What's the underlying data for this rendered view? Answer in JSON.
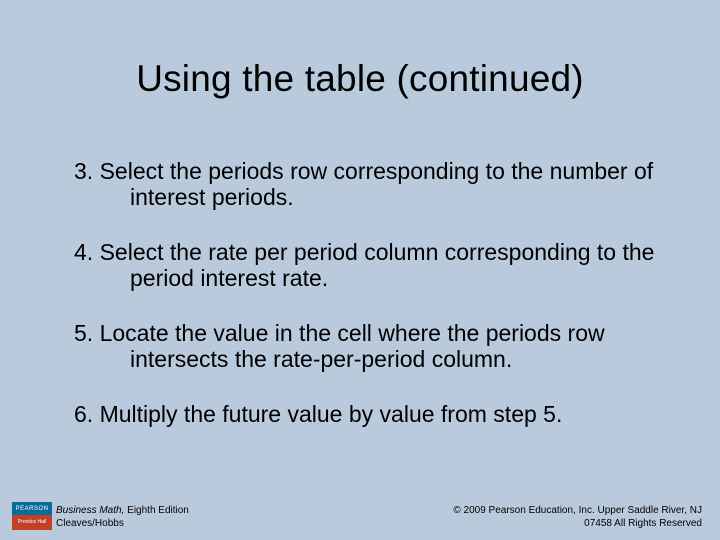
{
  "title": "Using the table (continued)",
  "items": [
    "3. Select the periods row corresponding to the number of interest periods.",
    "4. Select the rate per period column corresponding to the period interest rate.",
    "5. Locate the value in the cell where the periods row intersects the rate-per-period column.",
    "6. Multiply the future value by value from step 5."
  ],
  "footer": {
    "book": "Business Math,",
    "edition": " Eighth Edition",
    "authors": "Cleaves/Hobbs",
    "copyright_line1": "© 2009 Pearson Education, Inc. Upper Saddle River, NJ",
    "copyright_line2": "07458  All Rights Reserved"
  },
  "logo": {
    "top": "PEARSON",
    "bottom": "Prentice Hall"
  }
}
